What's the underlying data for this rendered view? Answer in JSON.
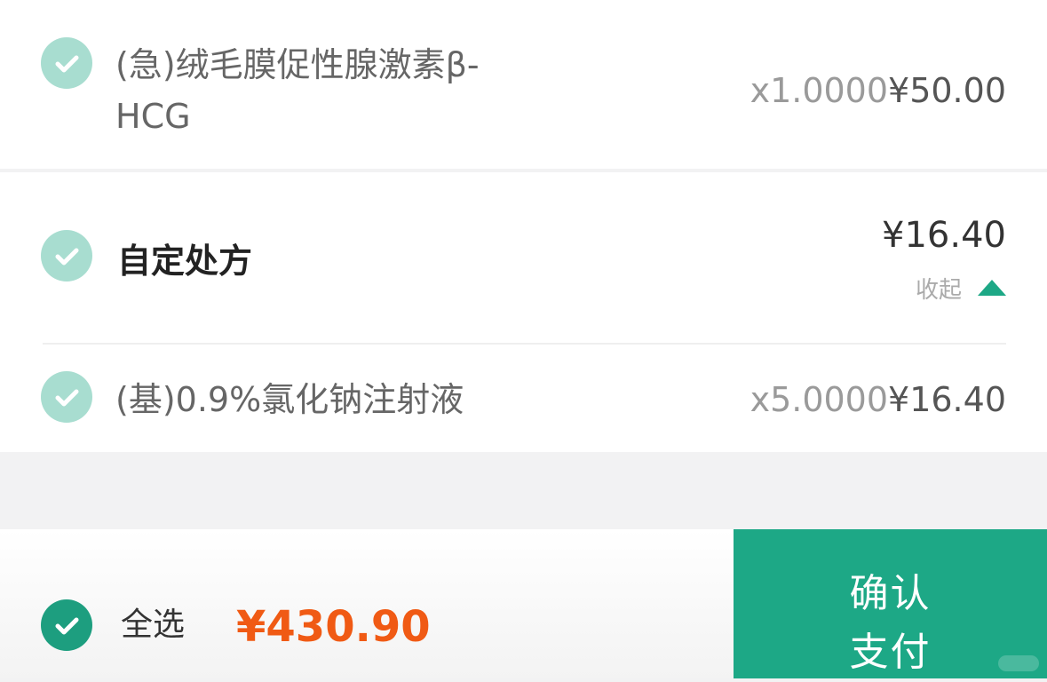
{
  "items": [
    {
      "name_line1": "(急)绒毛膜促性腺激素β-",
      "name_line2": "HCG",
      "qty": "x1.0000",
      "price": "¥50.00",
      "checked": true
    },
    {
      "name_line1": "(基)0.9%氯化钠注射液",
      "qty": "x5.0000",
      "price": "¥16.40",
      "checked": true
    }
  ],
  "group": {
    "name": "自定处方",
    "price": "¥16.40",
    "collapse_label": "收起",
    "checked": true
  },
  "footer": {
    "select_all_label": "全选",
    "total": "¥430.90",
    "pay_label_line1": "确认",
    "pay_label_line2": "支付"
  },
  "colors": {
    "accent": "#1da886",
    "check_light": "#a8ddd0",
    "total_price": "#f05a14"
  },
  "icons": {
    "item_check": "check-circle-icon",
    "collapse": "triangle-up-icon"
  }
}
